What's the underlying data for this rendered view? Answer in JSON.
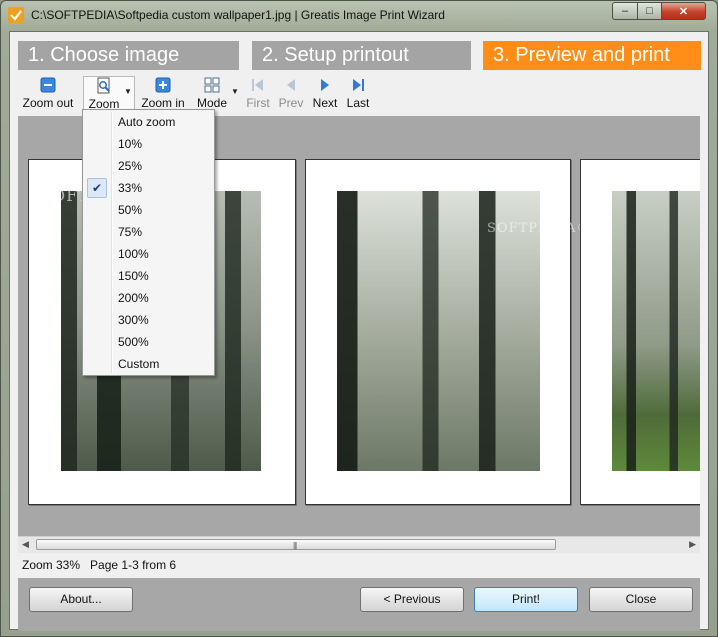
{
  "window": {
    "title": "C:\\SOFTPEDIA\\Softpedia custom wallpaper1.jpg | Greatis Image Print Wizard",
    "caption_min": "–",
    "caption_max": "□",
    "caption_close": "✕"
  },
  "steps": [
    {
      "label": "1. Choose image",
      "active": false
    },
    {
      "label": "2. Setup printout",
      "active": false
    },
    {
      "label": "3. Preview and print",
      "active": true
    }
  ],
  "toolbar": {
    "zoom_out": "Zoom out",
    "zoom": "Zoom",
    "zoom_in": "Zoom in",
    "mode": "Mode",
    "first": "First",
    "prev": "Prev",
    "next": "Next",
    "last": "Last"
  },
  "zoom_menu": {
    "selected": "33%",
    "items": [
      "Auto zoom",
      "10%",
      "25%",
      "33%",
      "50%",
      "75%",
      "100%",
      "150%",
      "200%",
      "300%",
      "500%",
      "Custom"
    ]
  },
  "preview": {
    "watermark": "SOFTPEDIA",
    "watermark_mark": "®"
  },
  "status": {
    "zoom": "Zoom 33%",
    "pages": "Page 1-3 from 6"
  },
  "buttons": {
    "about": "About...",
    "previous": "< Previous",
    "print": "Print!",
    "close": "Close"
  },
  "colors": {
    "active_step": "#ff8d17",
    "inactive_step": "#a4a4a4",
    "preview_bg": "#a7a7a7"
  }
}
